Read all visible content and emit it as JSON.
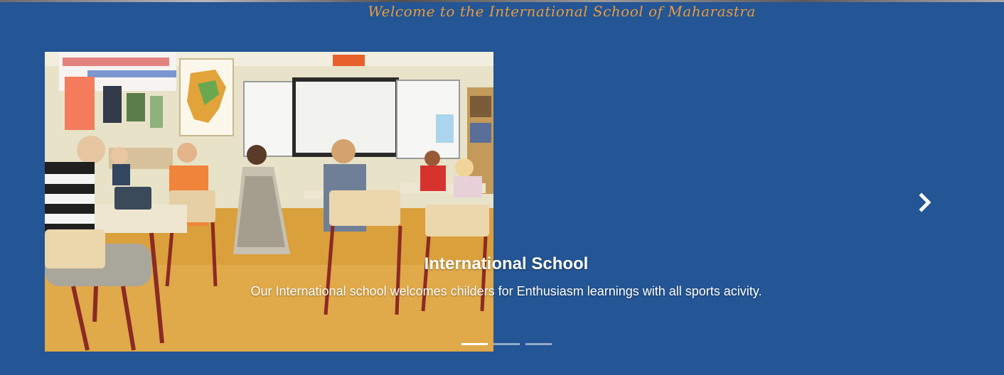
{
  "header": {
    "welcome_text": "Welcome to the International School of Maharastra"
  },
  "carousel": {
    "caption_title": "International School",
    "caption_text": "Our International school welcomes childers for Enthusiasm learnings with all sports acivity.",
    "slide_image_icon": "classroom-photo",
    "next_icon": "chevron-right-icon",
    "indicator_count": 3,
    "active_indicator": 1
  },
  "colors": {
    "background": "#245594",
    "welcome_text": "#e59b3f",
    "caption_text": "#ffffff"
  }
}
